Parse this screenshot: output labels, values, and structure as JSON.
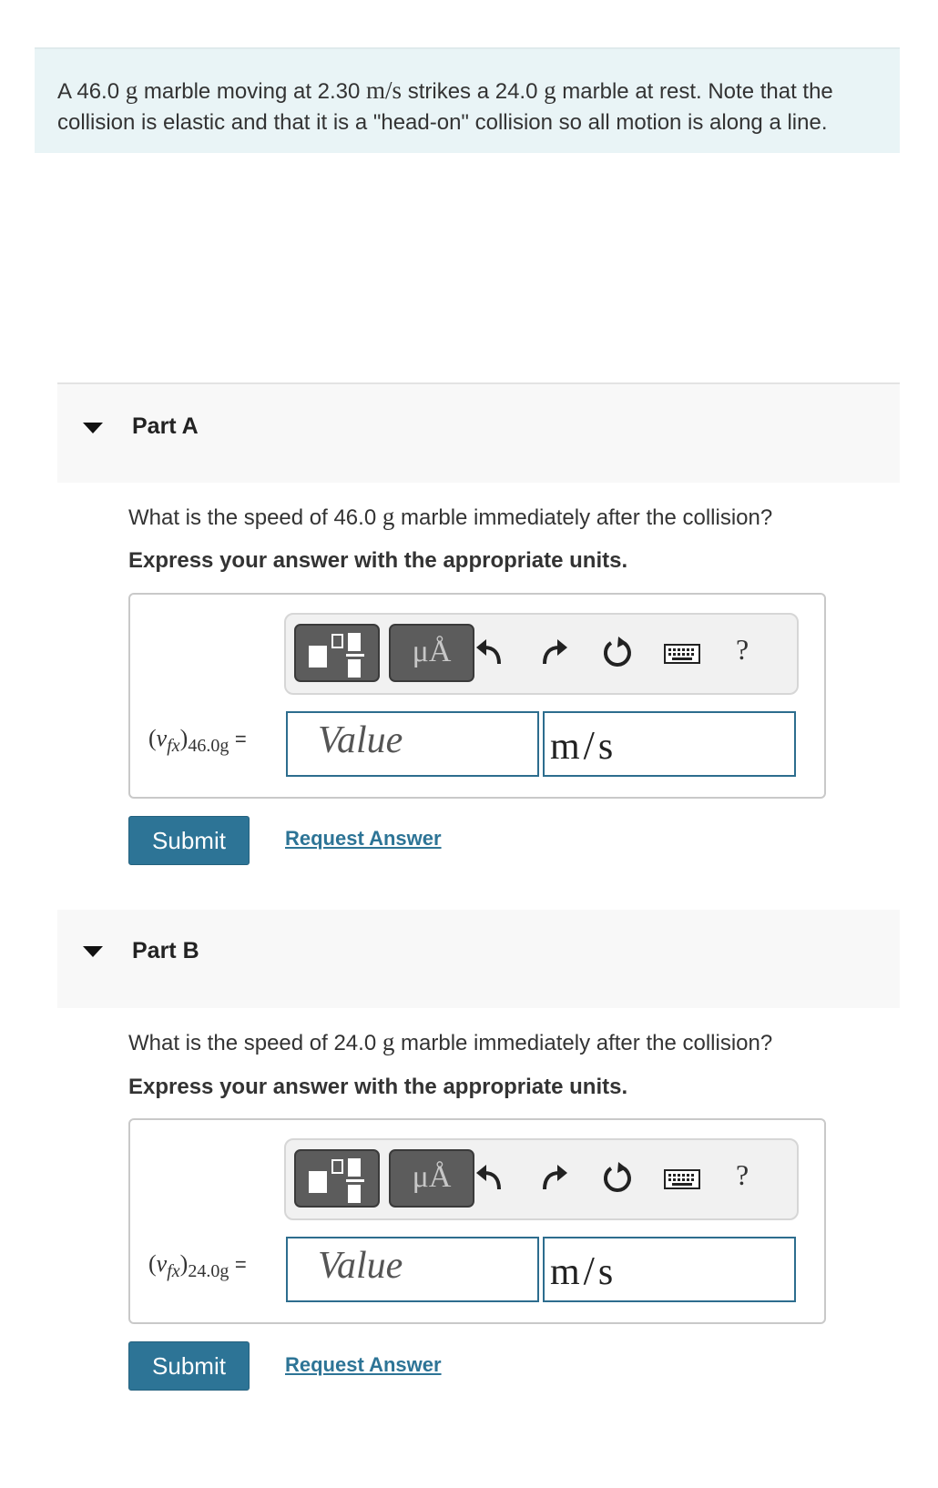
{
  "problem": {
    "text_1": "A 46.0 ",
    "unit_g_1": "g",
    "text_2": " marble moving at 2.30 ",
    "unit_speed": "m/s",
    "text_3": " strikes a 24.0 ",
    "unit_g_2": "g",
    "text_4": " marble at rest. Note that the collision is elastic and that it is a \"head-on\" collision so all motion is along a line."
  },
  "parts": [
    {
      "title": "Part A",
      "question_pre": "What is the speed of 46.0 ",
      "question_unit": "g",
      "question_post": " marble immediately after the collision?",
      "instruction": "Express your answer with the appropriate units.",
      "var_open": "(",
      "var_symbol": "v",
      "var_sub": "fx",
      "var_close": ")",
      "var_mass": "46.0g",
      "equals": "=",
      "value_placeholder": "Value",
      "units_m": "m",
      "units_slash": "/",
      "units_s": "s",
      "submit_label": "Submit",
      "request_label": "Request Answer"
    },
    {
      "title": "Part B",
      "question_pre": "What is the speed of 24.0 ",
      "question_unit": "g",
      "question_post": " marble immediately after the collision?",
      "instruction": "Express your answer with the appropriate units.",
      "var_open": "(",
      "var_symbol": "v",
      "var_sub": "fx",
      "var_close": ")",
      "var_mass": "24.0g",
      "equals": "=",
      "value_placeholder": "Value",
      "units_m": "m",
      "units_slash": "/",
      "units_s": "s",
      "submit_label": "Submit",
      "request_label": "Request Answer"
    }
  ],
  "toolbar": {
    "units_button_label": "μÅ",
    "help_label": "?",
    "icons": [
      "templates-icon",
      "undo-icon",
      "redo-icon",
      "reset-icon",
      "keyboard-icon",
      "help-icon"
    ]
  },
  "colors": {
    "intro_bg": "#e9f4f6",
    "accent": "#2d7496",
    "field_border": "#2d6d8e",
    "part_header_bg": "#f8f8f8"
  }
}
